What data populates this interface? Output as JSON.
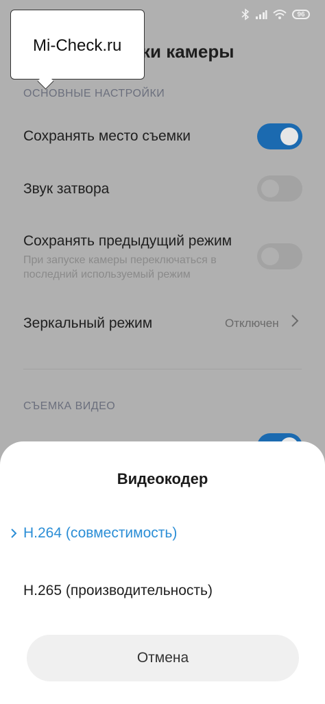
{
  "status_bar": {
    "battery": "96"
  },
  "header": {
    "title": "йки камеры"
  },
  "watermark": {
    "text": "Mi-Check.ru"
  },
  "sections": {
    "main": "ОСНОВНЫЕ НАСТРОЙКИ",
    "video": "СЪЕМКА ВИДЕО"
  },
  "settings": {
    "save_location": {
      "label": "Сохранять место съемки",
      "enabled": true
    },
    "shutter_sound": {
      "label": "Звук затвора",
      "enabled": false
    },
    "keep_mode": {
      "label": "Сохранять предыдущий режим",
      "description": "При запуске камеры переключаться в последний используемый режим",
      "enabled": false
    },
    "mirror_mode": {
      "label": "Зеркальный режим",
      "value": "Отключен"
    }
  },
  "sheet": {
    "title": "Видеокодер",
    "options": [
      {
        "label": "H.264 (совместимость)",
        "selected": true
      },
      {
        "label": "H.265 (производительность)",
        "selected": false
      }
    ],
    "cancel_label": "Отмена"
  },
  "colors": {
    "accent": "#2b8ed6",
    "toggle_on": "#1b6ab0"
  }
}
